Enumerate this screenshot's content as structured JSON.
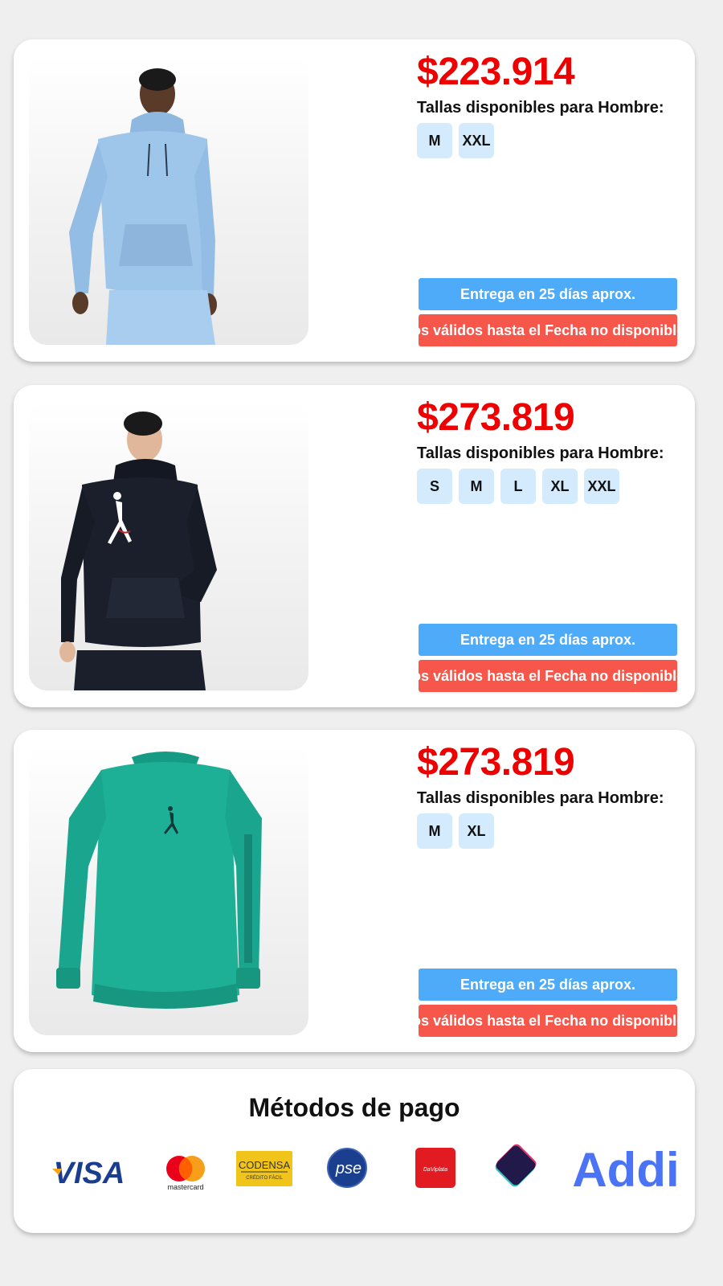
{
  "products": [
    {
      "price": "$223.914",
      "sizes_label": "Tallas disponibles para Hombre:",
      "sizes": [
        "M",
        "XXL"
      ],
      "shipping": "Entrega en 25 días aprox.",
      "validity": "Precios válidos hasta el Fecha no disponible",
      "garment_color": "#9ec6ea"
    },
    {
      "price": "$273.819",
      "sizes_label": "Tallas disponibles para Hombre:",
      "sizes": [
        "S",
        "M",
        "L",
        "XL",
        "XXL"
      ],
      "shipping": "Entrega en 25 días aprox.",
      "validity": "Precios válidos hasta el Fecha no disponible",
      "garment_color": "#1b1f2b"
    },
    {
      "price": "$273.819",
      "sizes_label": "Tallas disponibles para Hombre:",
      "sizes": [
        "M",
        "XL"
      ],
      "shipping": "Entrega en 25 días aprox.",
      "validity": "Precios válidos hasta el Fecha no disponible",
      "garment_color": "#1eb097"
    }
  ],
  "payment": {
    "title": "Métodos de pago",
    "logos": {
      "visa": "VISA",
      "mastercard": "mastercard",
      "codensa": "CODENSA",
      "codensa_sub": "CRÉDITO FÁCIL",
      "pse": "pse",
      "daviplata": "DaViplata",
      "addi": "Addi"
    }
  },
  "colors": {
    "price": "#ee0000",
    "shipping_bg": "#4eabf9",
    "validity_bg": "#f7574b",
    "size_bg": "#d4ebfd"
  }
}
